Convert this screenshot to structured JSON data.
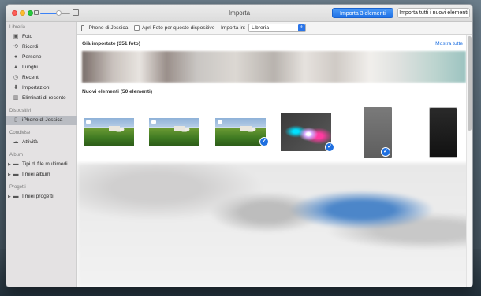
{
  "window": {
    "title": "Importa"
  },
  "buttons": {
    "import_selected": "Importa 3 elementi",
    "import_all": "Importa tutti i nuovi elementi"
  },
  "sidebar": {
    "sections": [
      {
        "header": "Libreria",
        "items": [
          {
            "label": "Foto",
            "icon": "photos-icon"
          },
          {
            "label": "Ricordi",
            "icon": "memories-icon"
          },
          {
            "label": "Persone",
            "icon": "people-icon"
          },
          {
            "label": "Luoghi",
            "icon": "places-icon"
          },
          {
            "label": "Recenti",
            "icon": "recents-icon"
          },
          {
            "label": "Importazioni",
            "icon": "imports-icon"
          },
          {
            "label": "Eliminati di recente",
            "icon": "trash-icon"
          }
        ]
      },
      {
        "header": "Dispositivi",
        "items": [
          {
            "label": "iPhone di Jessica",
            "icon": "iphone-icon",
            "selected": true
          }
        ]
      },
      {
        "header": "Condivise",
        "items": [
          {
            "label": "Attività",
            "icon": "cloud-icon"
          }
        ]
      },
      {
        "header": "Album",
        "items": [
          {
            "label": "Tipi di file multimedi...",
            "icon": "folder-icon"
          },
          {
            "label": "I miei album",
            "icon": "folder-icon"
          }
        ]
      },
      {
        "header": "Progetti",
        "items": [
          {
            "label": "I miei progetti",
            "icon": "folder-icon"
          }
        ]
      }
    ]
  },
  "toolbar": {
    "device_name": "iPhone di Jessica",
    "open_photos_label": "Apri Foto per questo dispositivo",
    "open_photos_checked": false,
    "import_in_label": "Importa in:",
    "import_in_value": "Libreria"
  },
  "main": {
    "already_imported_title": "Già importate (351 foto)",
    "show_all_link": "Mostra tutte",
    "new_items_title": "Nuovi elementi (50 elementi)"
  },
  "colors": {
    "accent": "#1e6fe0"
  }
}
